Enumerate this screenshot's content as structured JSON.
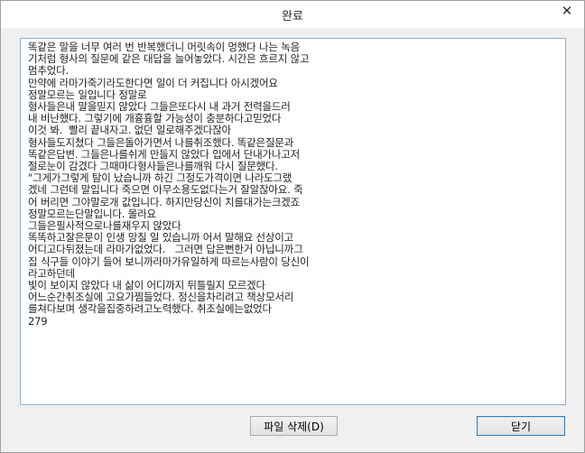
{
  "window": {
    "title": "완료",
    "close_glyph": "✕"
  },
  "log": {
    "lines": [
      "똑같은 말을 너무 여러 번 반복했더니 머릿속이 멍했다 나는 녹음",
      "기처럼 형사의 질문에 같은 대답을 늘어놓았다. 시간은 흐르지 않고",
      "멈추었다.",
      "만약에 라마가죽기라도한다면 일이 더 커집니다 아시겠어요",
      "정말모르는 일입니다 정말로",
      "형사들은내 말을믿지 않았다 그들은또다시 내 과거 전력을드러",
      "내 비난했다. 그렇기에 개흉흉할 가능성이 충분하다고믿었다",
      "이것 봐.  빨리 끝내자고. 없던 일로해주겠다잖아",
      "형사들도지쳤다 그들은돌아가면서 나를취조했다. 똑같은질문과",
      "똑같은답변. 그들은나를쉬게 만들지 않았다 입에서 단내가나고저",
      "절로눈이 감겼다 그때마다형사들은나를깨워 다시 질문했다.",
      "\"그게가그렇게 탐이 났습니까 하긴 그정도가격이면 나라도그랬",
      "겠네 그런데 말입니다 죽으면 아무소용도없다는거 잘알잖아요. 죽",
      "어 버리면 그야말로개 값입니다. 하지만당신이 치를대가는크겠죠",
      "정말모르는단말입니다. 몰라요",
      "그들은필사적으로나를재우지 않았다",
      "똑똑하고잘은문이 인생 망칠 일 있습니까 어서 말해요 선상이고",
      "어디고다뒤졌는데 라마가없었다.   그러면 답은뻔한거 아닙니까그",
      "집 식구들 이야기 들어 보니까라마가유일하게 따르는사람이 당신이",
      "라고하던데",
      "빛이 보이지 않았다 내 삶이 어디까지 뒤틀릴지 모르겠다",
      "어느순간취조실에 고요가찜들었다. 정신을차리려고 책상모서리",
      "를쳐다보며 생각을집중하려고노력했다. 취조실에는없었다",
      "279"
    ]
  },
  "buttons": {
    "delete_label": "파일 삭제(D)",
    "close_label": "닫기"
  }
}
